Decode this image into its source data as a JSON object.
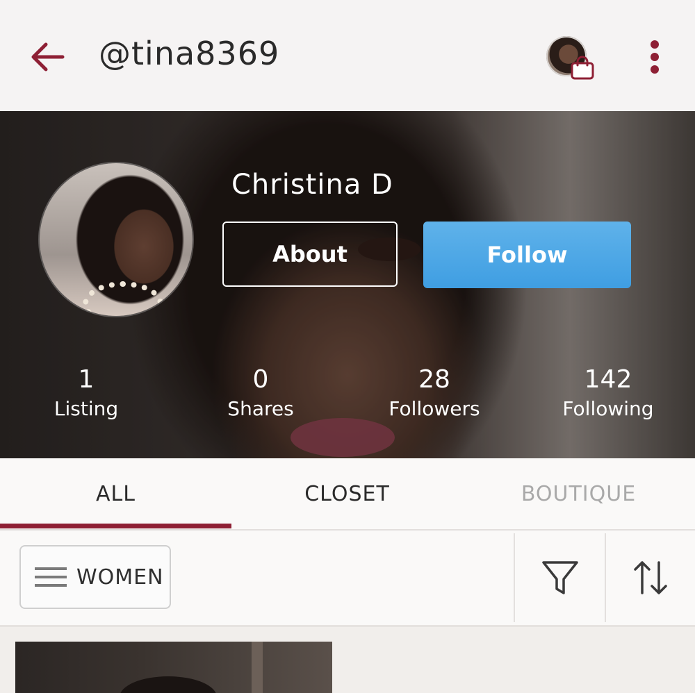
{
  "header": {
    "username": "@tina8369",
    "icons": {
      "back": "arrow-left-icon",
      "shop": "shopping-bag-icon",
      "more": "more-vertical-icon"
    },
    "accent_color": "#8e1f34"
  },
  "profile": {
    "name": "Christina D",
    "about_label": "About",
    "follow_label": "Follow",
    "stats": [
      {
        "value": "1",
        "label": "Listing"
      },
      {
        "value": "0",
        "label": "Shares"
      },
      {
        "value": "28",
        "label": "Followers"
      },
      {
        "value": "142",
        "label": "Following"
      }
    ]
  },
  "tabs": [
    {
      "label": "ALL",
      "active": true
    },
    {
      "label": "CLOSET",
      "active": false
    },
    {
      "label": "BOUTIQUE",
      "active": false,
      "disabled": true
    }
  ],
  "filters": {
    "department": "WOMEN",
    "icons": {
      "menu": "hamburger-icon",
      "filter": "filter-funnel-icon",
      "sort": "sort-arrows-icon"
    }
  },
  "colors": {
    "follow_button": "#4aa7e6",
    "tab_indicator": "#8e1f34"
  }
}
